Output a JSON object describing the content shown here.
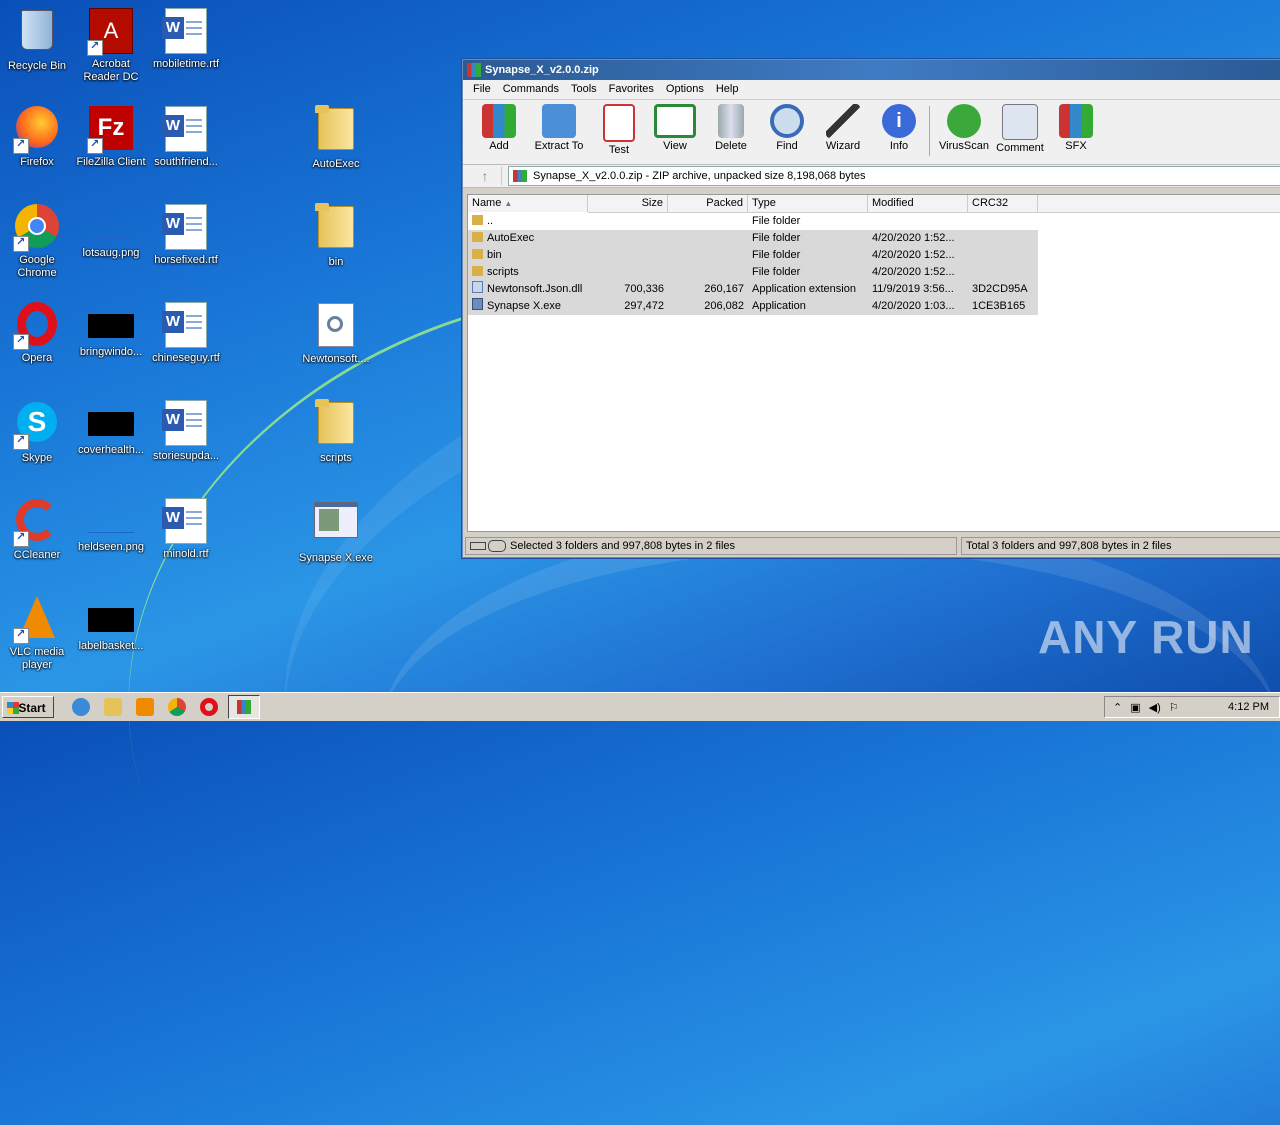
{
  "desktop": {
    "icons": [
      {
        "label": "Recycle Bin"
      },
      {
        "label": "Acrobat Reader DC"
      },
      {
        "label": "mobiletime.rtf"
      },
      {
        "label": "Firefox"
      },
      {
        "label": "FileZilla Client"
      },
      {
        "label": "southfriend..."
      },
      {
        "label": "AutoExec"
      },
      {
        "label": "Google Chrome"
      },
      {
        "label": "lotsaug.png"
      },
      {
        "label": "horsefixed.rtf"
      },
      {
        "label": "bin"
      },
      {
        "label": "Opera"
      },
      {
        "label": "bringwindo..."
      },
      {
        "label": "chineseguy.rtf"
      },
      {
        "label": "Newtonsoft...."
      },
      {
        "label": "Skype"
      },
      {
        "label": "coverhealth..."
      },
      {
        "label": "storiesupda..."
      },
      {
        "label": "scripts"
      },
      {
        "label": "CCleaner"
      },
      {
        "label": "heldseen.png"
      },
      {
        "label": "minold.rtf"
      },
      {
        "label": "Synapse X.exe"
      },
      {
        "label": "VLC media player"
      },
      {
        "label": "labelbasket..."
      }
    ]
  },
  "window": {
    "title": "Synapse_X_v2.0.0.zip",
    "menu": [
      "File",
      "Commands",
      "Tools",
      "Favorites",
      "Options",
      "Help"
    ],
    "toolbar": [
      "Add",
      "Extract To",
      "Test",
      "View",
      "Delete",
      "Find",
      "Wizard",
      "Info",
      "VirusScan",
      "Comment",
      "SFX"
    ],
    "address": "Synapse_X_v2.0.0.zip - ZIP archive, unpacked size 8,198,068 bytes",
    "columns": [
      "Name",
      "Size",
      "Packed",
      "Type",
      "Modified",
      "CRC32"
    ],
    "rows": [
      {
        "name": "..",
        "size": "",
        "packed": "",
        "type": "File folder",
        "modified": "",
        "crc": ""
      },
      {
        "name": "AutoExec",
        "size": "",
        "packed": "",
        "type": "File folder",
        "modified": "4/20/2020 1:52...",
        "crc": ""
      },
      {
        "name": "bin",
        "size": "",
        "packed": "",
        "type": "File folder",
        "modified": "4/20/2020 1:52...",
        "crc": ""
      },
      {
        "name": "scripts",
        "size": "",
        "packed": "",
        "type": "File folder",
        "modified": "4/20/2020 1:52...",
        "crc": ""
      },
      {
        "name": "Newtonsoft.Json.dll",
        "size": "700,336",
        "packed": "260,167",
        "type": "Application extension",
        "modified": "11/9/2019 3:56...",
        "crc": "3D2CD95A"
      },
      {
        "name": "Synapse X.exe",
        "size": "297,472",
        "packed": "206,082",
        "type": "Application",
        "modified": "4/20/2020 1:03...",
        "crc": "1CE3B165"
      }
    ],
    "status_left": "Selected 3 folders and 997,808 bytes in 2 files",
    "status_right": "Total 3 folders and 997,808 bytes in 2 files"
  },
  "taskbar": {
    "start": "Start",
    "clock": "4:12 PM"
  },
  "watermark": "ANY RUN"
}
